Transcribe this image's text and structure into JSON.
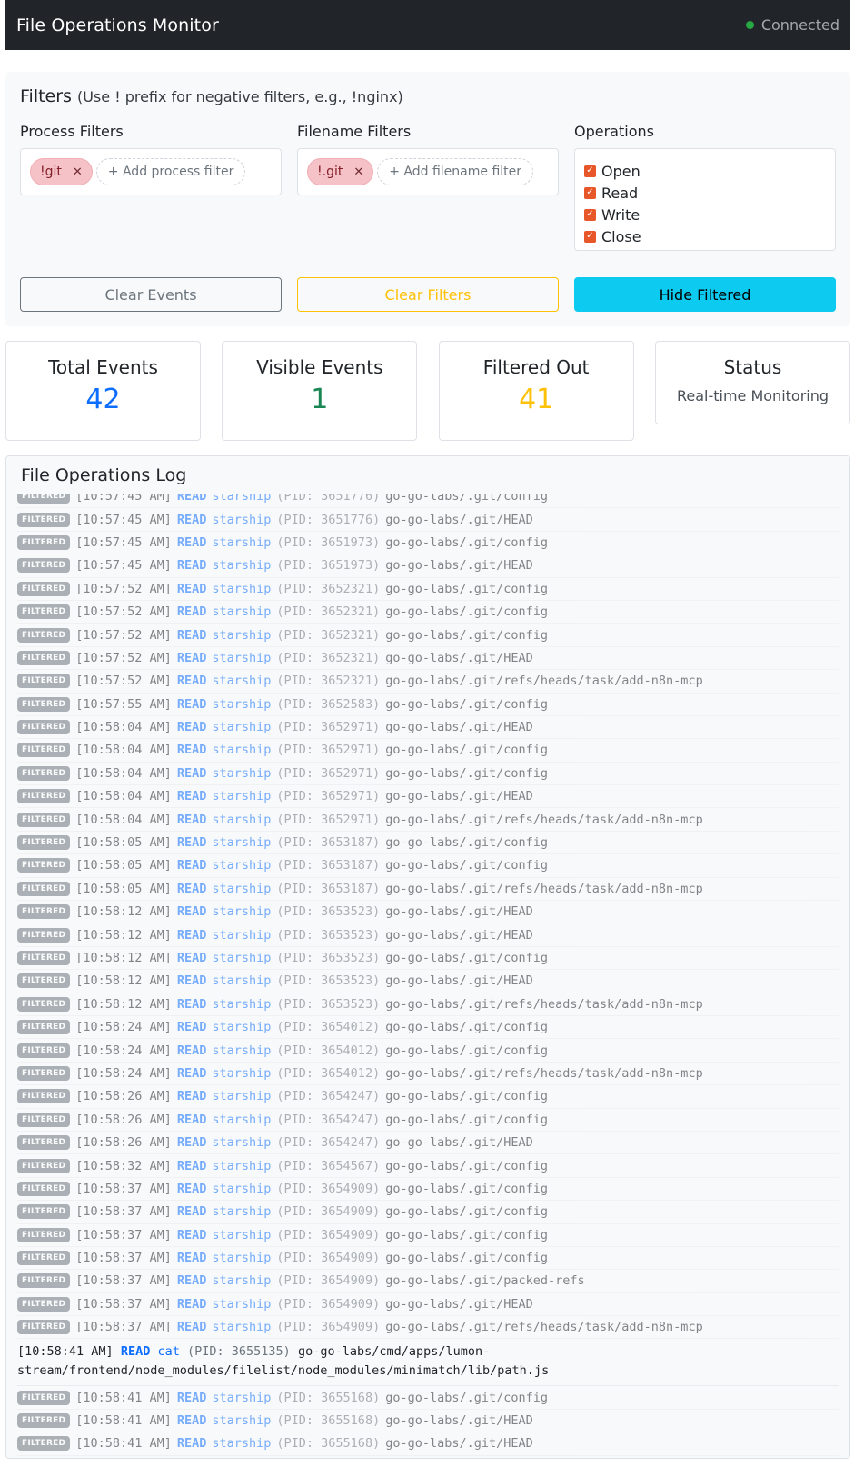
{
  "navbar": {
    "title": "File Operations Monitor",
    "status": "Connected"
  },
  "filters": {
    "title": "Filters",
    "hint": "(Use ! prefix for negative filters, e.g., !nginx)",
    "process": {
      "label": "Process Filters",
      "tags": [
        "!git"
      ],
      "add_placeholder": "+ Add process filter"
    },
    "filename": {
      "label": "Filename Filters",
      "tags": [
        "!.git"
      ],
      "add_placeholder": "+ Add filename filter"
    },
    "operations": {
      "label": "Operations",
      "items": [
        {
          "label": "Open",
          "checked": true
        },
        {
          "label": "Read",
          "checked": true
        },
        {
          "label": "Write",
          "checked": true
        },
        {
          "label": "Close",
          "checked": true
        }
      ]
    },
    "buttons": {
      "clear_events": "Clear Events",
      "clear_filters": "Clear Filters",
      "hide_filtered": "Hide Filtered"
    }
  },
  "stats": {
    "total": {
      "label": "Total Events",
      "value": "42"
    },
    "visible": {
      "label": "Visible Events",
      "value": "1"
    },
    "filtered": {
      "label": "Filtered Out",
      "value": "41"
    },
    "status": {
      "label": "Status",
      "value": "Real-time Monitoring"
    }
  },
  "log": {
    "title": "File Operations Log",
    "badge": "FILTERED",
    "entries": [
      {
        "filtered": true,
        "time": "[10:57:45 AM]",
        "op": "READ",
        "proc": "starship",
        "pid": "(PID: 3651776)",
        "path": "go-go-labs/.git/config"
      },
      {
        "filtered": true,
        "time": "[10:57:45 AM]",
        "op": "READ",
        "proc": "starship",
        "pid": "(PID: 3651776)",
        "path": "go-go-labs/.git/HEAD"
      },
      {
        "filtered": true,
        "time": "[10:57:45 AM]",
        "op": "READ",
        "proc": "starship",
        "pid": "(PID: 3651973)",
        "path": "go-go-labs/.git/config"
      },
      {
        "filtered": true,
        "time": "[10:57:45 AM]",
        "op": "READ",
        "proc": "starship",
        "pid": "(PID: 3651973)",
        "path": "go-go-labs/.git/HEAD"
      },
      {
        "filtered": true,
        "time": "[10:57:52 AM]",
        "op": "READ",
        "proc": "starship",
        "pid": "(PID: 3652321)",
        "path": "go-go-labs/.git/config"
      },
      {
        "filtered": true,
        "time": "[10:57:52 AM]",
        "op": "READ",
        "proc": "starship",
        "pid": "(PID: 3652321)",
        "path": "go-go-labs/.git/config"
      },
      {
        "filtered": true,
        "time": "[10:57:52 AM]",
        "op": "READ",
        "proc": "starship",
        "pid": "(PID: 3652321)",
        "path": "go-go-labs/.git/config"
      },
      {
        "filtered": true,
        "time": "[10:57:52 AM]",
        "op": "READ",
        "proc": "starship",
        "pid": "(PID: 3652321)",
        "path": "go-go-labs/.git/HEAD"
      },
      {
        "filtered": true,
        "time": "[10:57:52 AM]",
        "op": "READ",
        "proc": "starship",
        "pid": "(PID: 3652321)",
        "path": "go-go-labs/.git/refs/heads/task/add-n8n-mcp"
      },
      {
        "filtered": true,
        "time": "[10:57:55 AM]",
        "op": "READ",
        "proc": "starship",
        "pid": "(PID: 3652583)",
        "path": "go-go-labs/.git/config"
      },
      {
        "filtered": true,
        "time": "[10:58:04 AM]",
        "op": "READ",
        "proc": "starship",
        "pid": "(PID: 3652971)",
        "path": "go-go-labs/.git/HEAD"
      },
      {
        "filtered": true,
        "time": "[10:58:04 AM]",
        "op": "READ",
        "proc": "starship",
        "pid": "(PID: 3652971)",
        "path": "go-go-labs/.git/config"
      },
      {
        "filtered": true,
        "time": "[10:58:04 AM]",
        "op": "READ",
        "proc": "starship",
        "pid": "(PID: 3652971)",
        "path": "go-go-labs/.git/config"
      },
      {
        "filtered": true,
        "time": "[10:58:04 AM]",
        "op": "READ",
        "proc": "starship",
        "pid": "(PID: 3652971)",
        "path": "go-go-labs/.git/HEAD"
      },
      {
        "filtered": true,
        "time": "[10:58:04 AM]",
        "op": "READ",
        "proc": "starship",
        "pid": "(PID: 3652971)",
        "path": "go-go-labs/.git/refs/heads/task/add-n8n-mcp"
      },
      {
        "filtered": true,
        "time": "[10:58:05 AM]",
        "op": "READ",
        "proc": "starship",
        "pid": "(PID: 3653187)",
        "path": "go-go-labs/.git/config"
      },
      {
        "filtered": true,
        "time": "[10:58:05 AM]",
        "op": "READ",
        "proc": "starship",
        "pid": "(PID: 3653187)",
        "path": "go-go-labs/.git/config"
      },
      {
        "filtered": true,
        "time": "[10:58:05 AM]",
        "op": "READ",
        "proc": "starship",
        "pid": "(PID: 3653187)",
        "path": "go-go-labs/.git/refs/heads/task/add-n8n-mcp"
      },
      {
        "filtered": true,
        "time": "[10:58:12 AM]",
        "op": "READ",
        "proc": "starship",
        "pid": "(PID: 3653523)",
        "path": "go-go-labs/.git/HEAD"
      },
      {
        "filtered": true,
        "time": "[10:58:12 AM]",
        "op": "READ",
        "proc": "starship",
        "pid": "(PID: 3653523)",
        "path": "go-go-labs/.git/HEAD"
      },
      {
        "filtered": true,
        "time": "[10:58:12 AM]",
        "op": "READ",
        "proc": "starship",
        "pid": "(PID: 3653523)",
        "path": "go-go-labs/.git/config"
      },
      {
        "filtered": true,
        "time": "[10:58:12 AM]",
        "op": "READ",
        "proc": "starship",
        "pid": "(PID: 3653523)",
        "path": "go-go-labs/.git/HEAD"
      },
      {
        "filtered": true,
        "time": "[10:58:12 AM]",
        "op": "READ",
        "proc": "starship",
        "pid": "(PID: 3653523)",
        "path": "go-go-labs/.git/refs/heads/task/add-n8n-mcp"
      },
      {
        "filtered": true,
        "time": "[10:58:24 AM]",
        "op": "READ",
        "proc": "starship",
        "pid": "(PID: 3654012)",
        "path": "go-go-labs/.git/config"
      },
      {
        "filtered": true,
        "time": "[10:58:24 AM]",
        "op": "READ",
        "proc": "starship",
        "pid": "(PID: 3654012)",
        "path": "go-go-labs/.git/config"
      },
      {
        "filtered": true,
        "time": "[10:58:24 AM]",
        "op": "READ",
        "proc": "starship",
        "pid": "(PID: 3654012)",
        "path": "go-go-labs/.git/refs/heads/task/add-n8n-mcp"
      },
      {
        "filtered": true,
        "time": "[10:58:26 AM]",
        "op": "READ",
        "proc": "starship",
        "pid": "(PID: 3654247)",
        "path": "go-go-labs/.git/config"
      },
      {
        "filtered": true,
        "time": "[10:58:26 AM]",
        "op": "READ",
        "proc": "starship",
        "pid": "(PID: 3654247)",
        "path": "go-go-labs/.git/config"
      },
      {
        "filtered": true,
        "time": "[10:58:26 AM]",
        "op": "READ",
        "proc": "starship",
        "pid": "(PID: 3654247)",
        "path": "go-go-labs/.git/HEAD"
      },
      {
        "filtered": true,
        "time": "[10:58:32 AM]",
        "op": "READ",
        "proc": "starship",
        "pid": "(PID: 3654567)",
        "path": "go-go-labs/.git/config"
      },
      {
        "filtered": true,
        "time": "[10:58:37 AM]",
        "op": "READ",
        "proc": "starship",
        "pid": "(PID: 3654909)",
        "path": "go-go-labs/.git/config"
      },
      {
        "filtered": true,
        "time": "[10:58:37 AM]",
        "op": "READ",
        "proc": "starship",
        "pid": "(PID: 3654909)",
        "path": "go-go-labs/.git/config"
      },
      {
        "filtered": true,
        "time": "[10:58:37 AM]",
        "op": "READ",
        "proc": "starship",
        "pid": "(PID: 3654909)",
        "path": "go-go-labs/.git/config"
      },
      {
        "filtered": true,
        "time": "[10:58:37 AM]",
        "op": "READ",
        "proc": "starship",
        "pid": "(PID: 3654909)",
        "path": "go-go-labs/.git/config"
      },
      {
        "filtered": true,
        "time": "[10:58:37 AM]",
        "op": "READ",
        "proc": "starship",
        "pid": "(PID: 3654909)",
        "path": "go-go-labs/.git/packed-refs"
      },
      {
        "filtered": true,
        "time": "[10:58:37 AM]",
        "op": "READ",
        "proc": "starship",
        "pid": "(PID: 3654909)",
        "path": "go-go-labs/.git/HEAD"
      },
      {
        "filtered": true,
        "time": "[10:58:37 AM]",
        "op": "READ",
        "proc": "starship",
        "pid": "(PID: 3654909)",
        "path": "go-go-labs/.git/refs/heads/task/add-n8n-mcp"
      },
      {
        "filtered": false,
        "time": "[10:58:41 AM]",
        "op": "READ",
        "proc": "cat",
        "pid": "(PID: 3655135)",
        "path": "go-go-labs/cmd/apps/lumon-stream/frontend/node_modules/filelist/node_modules/minimatch/lib/path.js"
      },
      {
        "filtered": true,
        "time": "[10:58:41 AM]",
        "op": "READ",
        "proc": "starship",
        "pid": "(PID: 3655168)",
        "path": "go-go-labs/.git/config"
      },
      {
        "filtered": true,
        "time": "[10:58:41 AM]",
        "op": "READ",
        "proc": "starship",
        "pid": "(PID: 3655168)",
        "path": "go-go-labs/.git/HEAD"
      },
      {
        "filtered": true,
        "time": "[10:58:41 AM]",
        "op": "READ",
        "proc": "starship",
        "pid": "(PID: 3655168)",
        "path": "go-go-labs/.git/HEAD"
      }
    ]
  },
  "colors": {
    "navbar_bg": "#212529",
    "connected_dot": "#28a745",
    "total_value": "#0d6efd",
    "visible_value": "#198754",
    "filtered_value": "#ffc107",
    "hide_button": "#0dcaf0",
    "filter_tag": "#f5c2c7",
    "checkbox": "#e8572a"
  },
  "icons": {
    "connected": "status-dot-icon",
    "tag_remove": "close-icon",
    "checkbox": "checkbox-checked-icon"
  }
}
